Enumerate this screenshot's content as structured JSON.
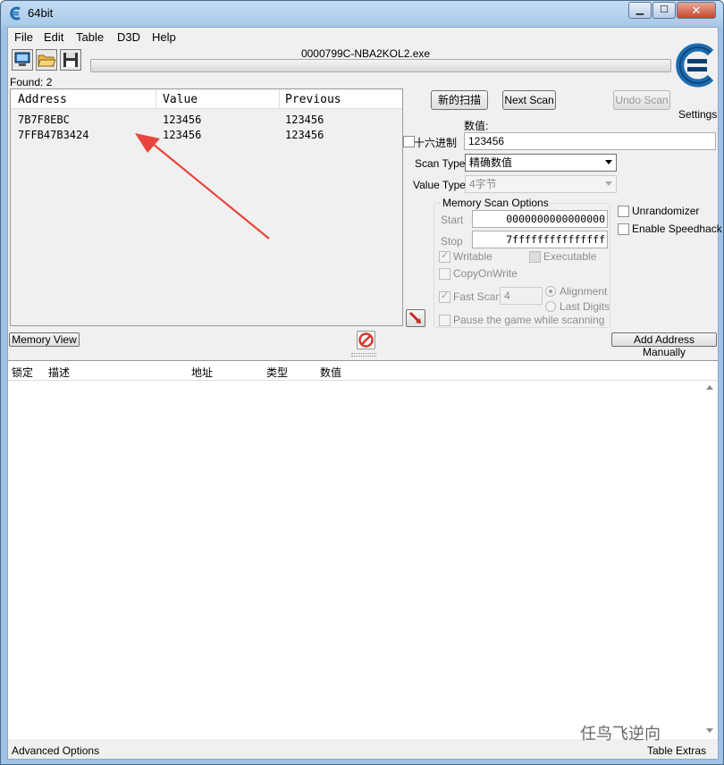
{
  "window": {
    "title": "64bit"
  },
  "menu": {
    "items": [
      "File",
      "Edit",
      "Table",
      "D3D",
      "Help"
    ]
  },
  "toolbar": {
    "process_name": "0000799C-NBA2KOL2.exe",
    "settings_label": "Settings"
  },
  "results": {
    "found_label": "Found: 2",
    "columns": [
      "Address",
      "Value",
      "Previous"
    ],
    "rows": [
      {
        "address": "7B7F8EBC",
        "value": "123456",
        "previous": "123456"
      },
      {
        "address": "7FFB47B3424",
        "value": "123456",
        "previous": "123456"
      }
    ]
  },
  "scan": {
    "new_scan_label": "新的扫描",
    "next_scan_label": "Next Scan",
    "undo_scan_label": "Undo Scan",
    "value_caption": "数值:",
    "hex_label": "十六进制",
    "value_input": "123456",
    "scan_type_label": "Scan Type",
    "scan_type_value": "精确数值",
    "value_type_label": "Value Type",
    "value_type_value": "4字节"
  },
  "memory_scan_options": {
    "title": "Memory Scan Options",
    "start_label": "Start",
    "start_value": "0000000000000000",
    "stop_label": "Stop",
    "stop_value": "7fffffffffffffff",
    "writable_label": "Writable",
    "executable_label": "Executable",
    "copyonwrite_label": "CopyOnWrite",
    "fast_scan_label": "Fast Scan",
    "fast_scan_value": "4",
    "alignment_label": "Alignment",
    "last_digits_label": "Last Digits",
    "pause_label": "Pause the game while scanning"
  },
  "side_options": {
    "unrandomizer_label": "Unrandomizer",
    "speedhack_label": "Enable Speedhack"
  },
  "buttons": {
    "memory_view_label": "Memory View",
    "add_address_label": "Add Address Manually"
  },
  "address_list": {
    "columns": [
      "锁定",
      "描述",
      "地址",
      "类型",
      "数值"
    ]
  },
  "bottom": {
    "advanced_options_label": "Advanced Options",
    "table_extras_label": "Table Extras"
  },
  "watermark": {
    "text": "任鸟飞逆向"
  },
  "colors": {
    "title_bar": "#b3d1ee",
    "arrow": "#e8453c",
    "stop_icon": "#d9342b"
  }
}
